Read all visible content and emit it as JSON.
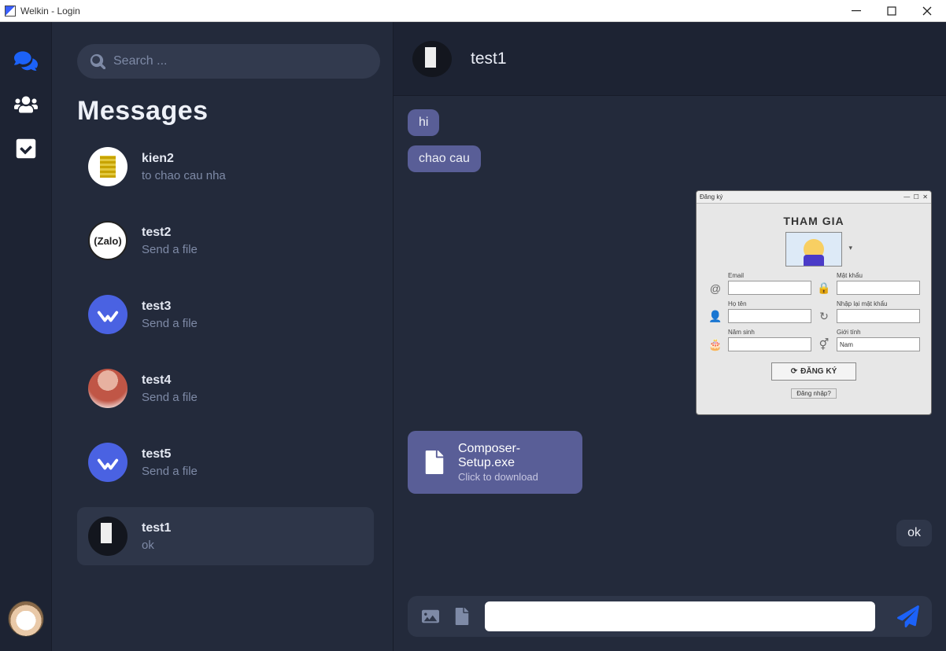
{
  "window": {
    "title": "Welkin - Login"
  },
  "search": {
    "placeholder": "Search ..."
  },
  "section_title": "Messages",
  "conversations": [
    {
      "name": "kien2",
      "preview": "to chao cau nha",
      "avatar": "kien",
      "active": false
    },
    {
      "name": "test2",
      "preview": "Send a file",
      "avatar": "zalo",
      "active": false
    },
    {
      "name": "test3",
      "preview": "Send a file",
      "avatar": "w",
      "active": false
    },
    {
      "name": "test4",
      "preview": "Send a file",
      "avatar": "musc",
      "active": false
    },
    {
      "name": "test5",
      "preview": "Send a file",
      "avatar": "w",
      "active": false
    },
    {
      "name": "test1",
      "preview": "ok",
      "avatar": "dark",
      "active": true
    }
  ],
  "chat": {
    "contact_name": "test1",
    "messages": {
      "m0": {
        "text": "hi"
      },
      "m1": {
        "text": "chao cau"
      },
      "m_ok": {
        "text": "ok"
      }
    },
    "file": {
      "name": "Composer-Setup.exe",
      "subtitle": "Click to download"
    },
    "embedded_form": {
      "window_title": "Đăng ký",
      "heading": "THAM GIA",
      "fields": {
        "email": "Email",
        "password": "Mật khẩu",
        "fullname": "Họ tên",
        "password_confirm": "Nhập lại mật khẩu",
        "birthyear": "Năm sinh",
        "gender": "Giới tính",
        "gender_value": "Nam"
      },
      "submit": "ĐĂNG KÝ",
      "login_link": "Đăng nhập?"
    }
  },
  "zalo_label": "(Zalo)"
}
